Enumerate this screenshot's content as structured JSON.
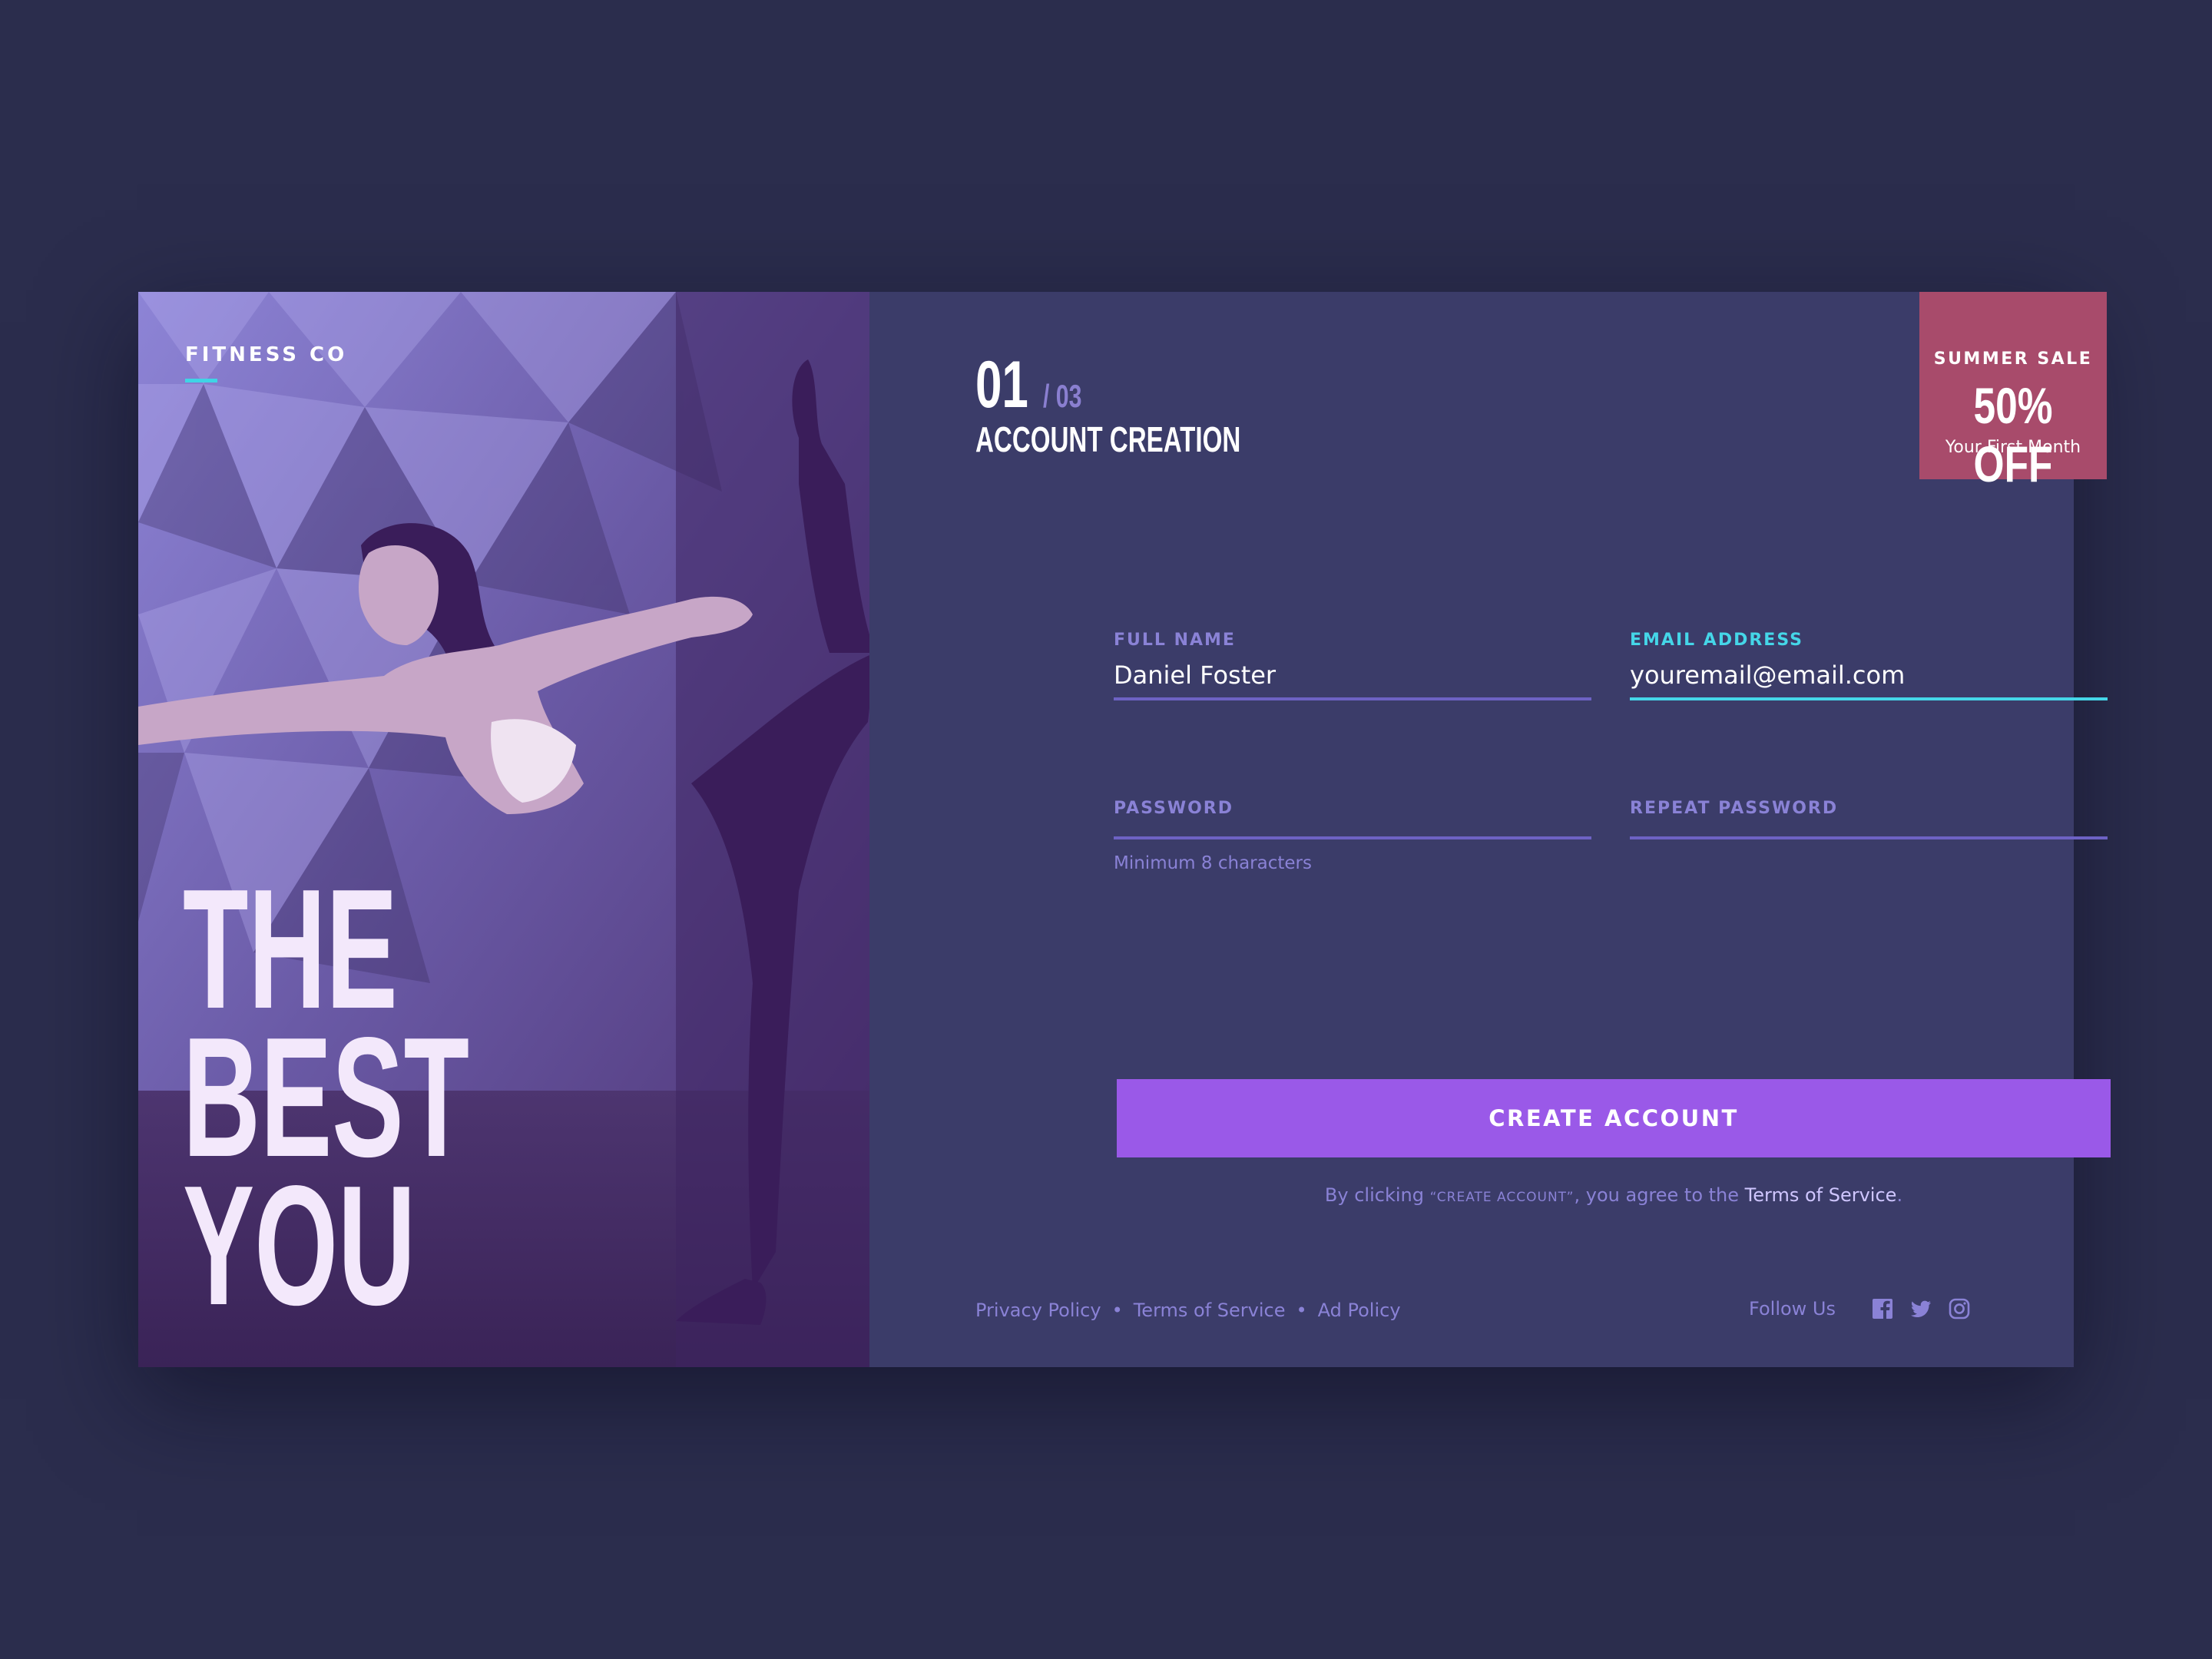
{
  "brand": {
    "name": "FITNESS CO"
  },
  "hero": {
    "lines": [
      "THE",
      "BEST",
      "YOU"
    ]
  },
  "step": {
    "current": "01",
    "total": "/ 03",
    "title": "ACCOUNT CREATION"
  },
  "promo": {
    "title": "SUMMER SALE",
    "offer": "50% OFF",
    "subtitle": "Your First Month"
  },
  "form": {
    "full_name": {
      "label": "FULL NAME",
      "value": "Daniel Foster"
    },
    "email": {
      "label": "EMAIL ADDRESS",
      "value": "youremail@email.com"
    },
    "password": {
      "label": "PASSWORD",
      "value": "",
      "hint": "Minimum 8 characters"
    },
    "repeat_password": {
      "label": "REPEAT PASSWORD",
      "value": ""
    },
    "submit_label": "CREATE ACCOUNT",
    "legal": {
      "prefix": "By clicking ",
      "quoted": "“CREATE ACCOUNT”",
      "middle": ", you agree to the ",
      "link": "Terms of Service",
      "suffix": "."
    }
  },
  "footer": {
    "links": [
      "Privacy Policy",
      "Terms of Service",
      "Ad Policy"
    ],
    "separator": "•",
    "follow_label": "Follow Us",
    "social_icons": [
      "facebook-icon",
      "twitter-icon",
      "instagram-icon"
    ]
  },
  "colors": {
    "page_bg": "#2b2d4d",
    "panel_bg": "#3b3c69",
    "accent_cyan": "#45d6e8",
    "button": "#9a59e8",
    "promo": "#a84b6b",
    "muted_text": "#8a82d6"
  }
}
